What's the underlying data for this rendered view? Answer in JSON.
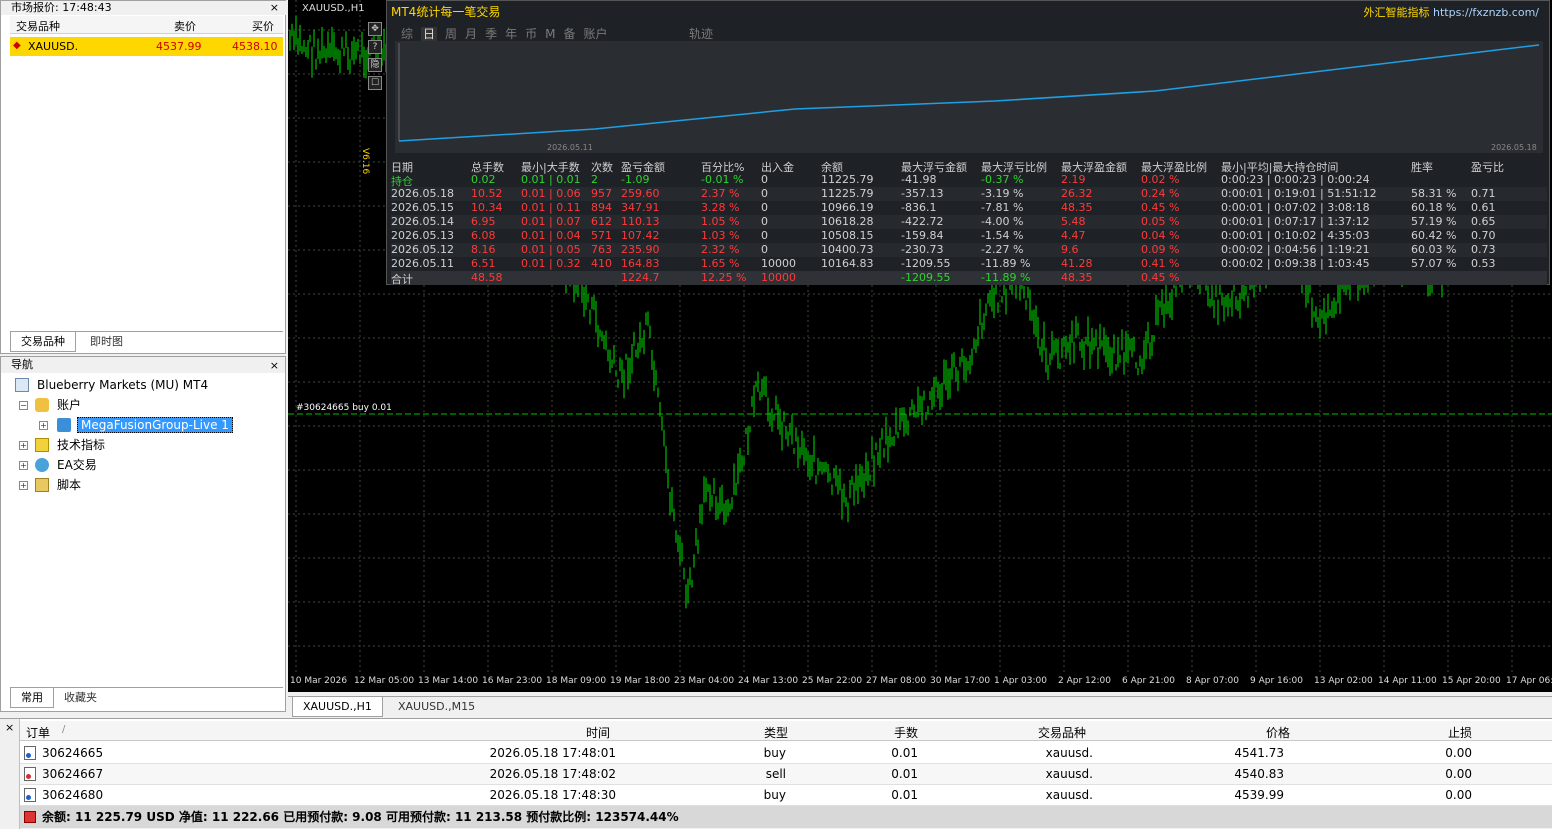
{
  "market_watch": {
    "title": "市场报价: 17:48:43",
    "col_symbol": "交易品种",
    "col_bid": "卖价",
    "col_ask": "买价",
    "symbol": "XAUUSD.",
    "bid": "4537.99",
    "ask": "4538.10",
    "tab_symbols": "交易品种",
    "tab_tick": "即时图"
  },
  "navigator": {
    "title": "导航",
    "broker": "Blueberry Markets (MU) MT4",
    "accounts": "账户",
    "account_item": "MegaFusionGroup-Live 1",
    "indicators": "技术指标",
    "experts": "EA交易",
    "scripts": "脚本",
    "tab_common": "常用",
    "tab_favorites": "收藏夹"
  },
  "chart": {
    "title": "XAUUSD.,H1",
    "order_line_label": "#30624665 buy 0.01",
    "side_label": "V6.16",
    "x_labels": [
      "10 Mar 2026",
      "12 Mar 05:00",
      "13 Mar 14:00",
      "16 Mar 23:00",
      "18 Mar 09:00",
      "19 Mar 18:00",
      "23 Mar 04:00",
      "24 Mar 13:00",
      "25 Mar 22:00",
      "27 Mar 08:00",
      "30 Mar 17:00",
      "1 Apr 03:00",
      "2 Apr 12:00",
      "6 Apr 21:00",
      "8 Apr 07:00",
      "9 Apr 16:00",
      "13 Apr 02:00",
      "14 Apr 11:00",
      "15 Apr 20:00",
      "17 Apr 06:00"
    ],
    "tabs": [
      "XAUUSD.,H1",
      "XAUUSD.,M15"
    ]
  },
  "panel": {
    "title": "MT4统计每一笔交易",
    "brand": "外汇智能指标",
    "url": "https://fxznzb.com/",
    "tabs": [
      "综",
      "日",
      "周",
      "月",
      "季",
      "年",
      "币",
      "M",
      "备",
      "账户"
    ],
    "active_tab": "日",
    "trail_label": "轨迹",
    "graph_start": "2026.05.11",
    "graph_end": "2026.05.18",
    "graph_line_color": "#1ea0e6",
    "headers": [
      "日期",
      "总手数",
      "最小|大手数",
      "次数",
      "盈亏金额",
      "百分比%",
      "出入金",
      "余额",
      "最大浮亏金额",
      "最大浮亏比例",
      "最大浮盈金额",
      "最大浮盈比例",
      "最小|平均|最大持仓时间",
      "胜率",
      "盈亏比"
    ],
    "rows": [
      [
        "持仓",
        "0.02",
        "0.01 | 0.01",
        "2",
        "-1.09",
        "-0.01 %",
        "0",
        "11225.79",
        "-41.98",
        "-0.37 %",
        "2.19",
        "0.02 %",
        "0:00:23 | 0:00:23 | 0:00:24",
        "",
        ""
      ],
      [
        "2026.05.18",
        "10.52",
        "0.01 | 0.06",
        "957",
        "259.60",
        "2.37 %",
        "0",
        "11225.79",
        "-357.13",
        "-3.19 %",
        "26.32",
        "0.24 %",
        "0:00:01 | 0:19:01 | 51:51:12",
        "58.31 %",
        "0.71"
      ],
      [
        "2026.05.15",
        "10.34",
        "0.01 | 0.11",
        "894",
        "347.91",
        "3.28 %",
        "0",
        "10966.19",
        "-836.1",
        "-7.81 %",
        "48.35",
        "0.45 %",
        "0:00:01 | 0:07:02 | 3:08:18",
        "60.18 %",
        "0.61"
      ],
      [
        "2026.05.14",
        "6.95",
        "0.01 | 0.07",
        "612",
        "110.13",
        "1.05 %",
        "0",
        "10618.28",
        "-422.72",
        "-4.00 %",
        "5.48",
        "0.05 %",
        "0:00:01 | 0:07:17 | 1:37:12",
        "57.19 %",
        "0.65"
      ],
      [
        "2026.05.13",
        "6.08",
        "0.01 | 0.04",
        "571",
        "107.42",
        "1.03 %",
        "0",
        "10508.15",
        "-159.84",
        "-1.54 %",
        "4.47",
        "0.04 %",
        "0:00:01 | 0:10:02 | 4:35:03",
        "60.42 %",
        "0.70"
      ],
      [
        "2026.05.12",
        "8.16",
        "0.01 | 0.05",
        "763",
        "235.90",
        "2.32 %",
        "0",
        "10400.73",
        "-230.73",
        "-2.27 %",
        "9.6",
        "0.09 %",
        "0:00:02 | 0:04:56 | 1:19:21",
        "60.03 %",
        "0.73"
      ],
      [
        "2026.05.11",
        "6.51",
        "0.01 | 0.32",
        "410",
        "164.83",
        "1.65 %",
        "10000",
        "10164.83",
        "-1209.55",
        "-11.89 %",
        "41.28",
        "0.41 %",
        "0:00:02 | 0:09:38 | 1:03:45",
        "57.07 %",
        "0.53"
      ]
    ],
    "total": [
      "合计",
      "48.58",
      "",
      "",
      "1224.7",
      "12.25 %",
      "10000",
      "",
      "-1209.55",
      "-11.89 %",
      "48.35",
      "0.45 %",
      "",
      "",
      ""
    ]
  },
  "terminal": {
    "headers": [
      "订单",
      "时间",
      "类型",
      "手数",
      "交易品种",
      "价格",
      "止损"
    ],
    "rows": [
      {
        "order": "30624665",
        "time": "2026.05.18 17:48:01",
        "type": "buy",
        "lots": "0.01",
        "symbol": "xauusd.",
        "price": "4541.73",
        "sl": "0.00"
      },
      {
        "order": "30624667",
        "time": "2026.05.18 17:48:02",
        "type": "sell",
        "lots": "0.01",
        "symbol": "xauusd.",
        "price": "4540.83",
        "sl": "0.00"
      },
      {
        "order": "30624680",
        "time": "2026.05.18 17:48:30",
        "type": "buy",
        "lots": "0.01",
        "symbol": "xauusd.",
        "price": "4539.99",
        "sl": "0.00"
      }
    ],
    "footer": "余额: 11 225.79 USD  净值: 11 222.66  已用预付款: 9.08  可用预付款: 11 213.58  预付款比例: 123574.44%"
  },
  "colors": {
    "candle": "#00e000",
    "grid": "#3a4a3a",
    "order_line": "#00c000",
    "highlight": "#ffd700"
  }
}
